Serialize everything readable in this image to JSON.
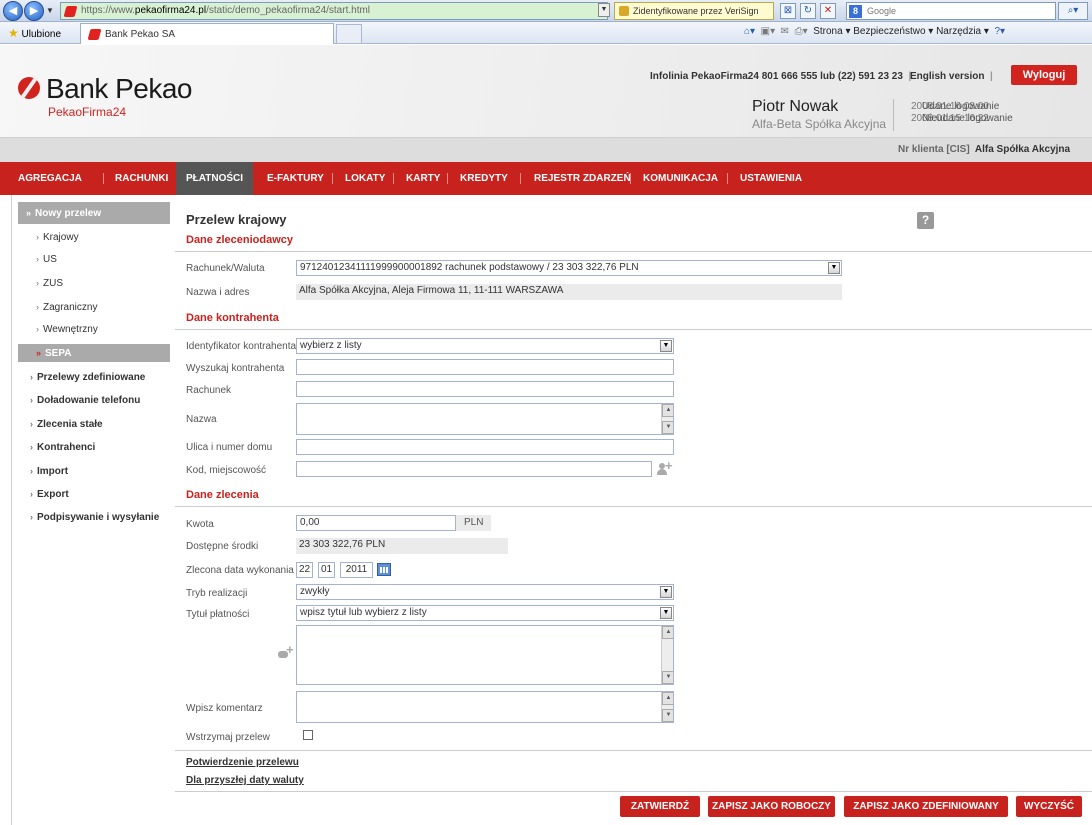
{
  "browser": {
    "url_prefix": "https://www.",
    "url_domain": "pekaofirma24.pl",
    "url_path": "/static/demo_pekaofirma24/start.html",
    "cert": "Zidentyfikowane przez VeriSign",
    "search_placeholder": "Google",
    "favorites": "Ulubione",
    "tab_title": "Bank Pekao SA",
    "toolbar_right": "Strona ▾   Bezpieczeństwo ▾   Narzędzia ▾"
  },
  "header": {
    "logo": "Bank Pekao",
    "logo_sub": "PekaoFirma24",
    "infoline": "Infolinia PekaoFirma24 801 666 555 lub (22) 591 23 23",
    "english": "English version",
    "logout": "Wyloguj",
    "user_name": "Piotr Nowak",
    "company": "Alfa-Beta Spółka Akcyjna",
    "login_ok_label": "Udane logowanie",
    "login_ok_value": "2008.01.16 08:00",
    "login_fail_label": "Nieudane logowanie",
    "login_fail_value": "2008.01.15 16:22",
    "client_label": "Nr klienta [CIS]",
    "client_value": "Alfa Spółka Akcyjna"
  },
  "menu": [
    "AGREGACJA",
    "RACHUNKI",
    "PŁATNOŚCI",
    "E-FAKTURY",
    "LOKATY",
    "KARTY",
    "KREDYTY",
    "REJESTR ZDARZEŃ",
    "KOMUNIKACJA",
    "USTAWIENIA"
  ],
  "sidebar": {
    "head": "Nowy przelew",
    "sub": [
      "Krajowy",
      "US",
      "ZUS",
      "Zagraniczny",
      "Wewnętrzny",
      "SEPA"
    ],
    "top": [
      "Przelewy zdefiniowane",
      "Doładowanie telefonu",
      "Zlecenia stałe",
      "Kontrahenci",
      "Import",
      "Export",
      "Podpisywanie i wysyłanie"
    ]
  },
  "form": {
    "title": "Przelew krajowy",
    "sec1": "Dane zleceniodawcy",
    "account_label": "Rachunek/Waluta",
    "account_value": "97124012341111999900001892 rachunek podstawowy / 23 303 322,76 PLN",
    "name_addr_label": "Nazwa i adres",
    "name_addr_value": "Alfa Spółka Akcyjna, Aleja Firmowa 11, 11-111 WARSZAWA",
    "sec2": "Dane kontrahenta",
    "ident_label": "Identyfikator kontrahenta",
    "ident_value": "wybierz z listy",
    "search_label": "Wyszukaj kontrahenta",
    "account2_label": "Rachunek",
    "nazwa_label": "Nazwa",
    "street_label": "Ulica i numer domu",
    "postal_label": "Kod, miejscowość",
    "sec3": "Dane zlecenia",
    "amount_label": "Kwota",
    "amount_value": "0,00",
    "currency": "PLN",
    "available_label": "Dostępne środki",
    "available_value": "23 303 322,76 PLN",
    "date_label": "Zlecona data wykonania",
    "date_day": "22",
    "date_month": "01",
    "date_year": "2011",
    "mode_label": "Tryb realizacji",
    "mode_value": "zwykły",
    "title_label": "Tytuł płatności",
    "title_value": "wpisz tytuł lub wybierz z listy",
    "comment_label": "Wpisz komentarz",
    "hold_label": "Wstrzymaj przelew",
    "link1": "Potwierdzenie przelewu",
    "link2": "Dla przyszłej daty waluty",
    "btn_confirm": "ZATWIERDŹ",
    "btn_draft": "ZAPISZ JAKO ROBOCZY",
    "btn_defined": "ZAPISZ JAKO ZDEFINIOWANY",
    "btn_clear": "WYCZYŚĆ"
  }
}
